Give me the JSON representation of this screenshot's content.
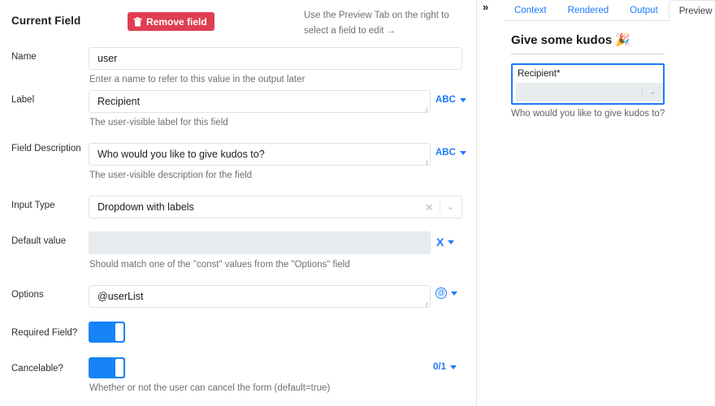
{
  "editor": {
    "panel_title": "Current Field",
    "remove_button": "Remove field",
    "remove_icon": "trash-icon",
    "hint": "Use the Preview Tab on the right to select a field to edit →",
    "accent_blue": "#1d7afc",
    "danger_red": "#e03e52",
    "toggle_on_color": "#1683f7",
    "fields": [
      {
        "label": "Name",
        "value": "user",
        "placeholder": "",
        "helper": "Enter a name to refer to this value in the output later",
        "adornment": null
      },
      {
        "label": "Label",
        "value": "Recipient",
        "placeholder": "",
        "helper": "The user-visible label for this field",
        "adornment": "ABC"
      },
      {
        "label": "Field Description",
        "value": "Who would you like to give kudos to?",
        "placeholder": "",
        "helper": "The user-visible description for the field",
        "adornment": "ABC"
      },
      {
        "label": "Input Type",
        "value": "Dropdown with labels",
        "placeholder": "",
        "helper": "",
        "adornment": null,
        "clear_icon": "close-icon",
        "dropdown_icon": "chevron-down-icon"
      },
      {
        "label": "Default value",
        "value": "",
        "placeholder": "",
        "helper": "Should match one of the \"const\" values from the \"Options\" field",
        "adornment": "X"
      },
      {
        "label": "Options",
        "value": "@userList",
        "placeholder": "",
        "helper": "",
        "adornment": "@"
      },
      {
        "label": "Required Field?",
        "toggle": true,
        "helper": "",
        "adornment": null
      },
      {
        "label": "Cancelable?",
        "toggle": true,
        "helper": "Whether or not the user can cancel the form (default=true)",
        "adornment": "0/1"
      }
    ]
  },
  "preview": {
    "collapse_icon": "chevron-double-right-icon",
    "tabs": [
      {
        "label": "Context",
        "active": false
      },
      {
        "label": "Rendered",
        "active": false
      },
      {
        "label": "Output",
        "active": false
      },
      {
        "label": "Preview",
        "active": true
      }
    ],
    "form_title": "Give some kudos 🎉",
    "field": {
      "label": "Recipient*",
      "value": "",
      "dropdown_icon": "chevron-down-icon",
      "description": "Who would you like to give kudos to?"
    }
  }
}
